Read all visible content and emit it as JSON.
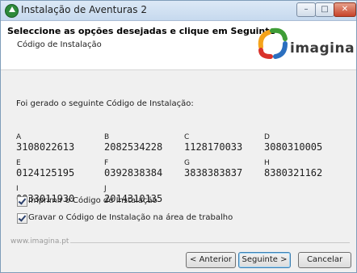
{
  "window": {
    "title": "Instalação de Aventuras 2",
    "controls": {
      "minimize": "–",
      "maximize": "□",
      "close": "✕"
    }
  },
  "header": {
    "title": "Seleccione as opções desejadas e clique em Seguinte",
    "subtitle": "Código de Instalação",
    "logo_text": "imagina",
    "logo_colors": [
      "#f5a31a",
      "#3f9d36",
      "#2b6fbf",
      "#d9322b"
    ]
  },
  "content": {
    "intro": "Foi gerado o seguinte Código de Instalação:",
    "codes": [
      {
        "letter": "A",
        "value": "3108022613"
      },
      {
        "letter": "B",
        "value": "2082534228"
      },
      {
        "letter": "C",
        "value": "1128170033"
      },
      {
        "letter": "D",
        "value": "3080310005"
      },
      {
        "letter": "E",
        "value": "0124125195"
      },
      {
        "letter": "F",
        "value": "0392838384"
      },
      {
        "letter": "G",
        "value": "3838383837"
      },
      {
        "letter": "H",
        "value": "8380321162"
      },
      {
        "letter": "I",
        "value": "0033011930"
      },
      {
        "letter": "J",
        "value": "2014310135"
      }
    ],
    "options": [
      {
        "label": "Imprimir o Código de Instalação",
        "checked": true
      },
      {
        "label": "Gravar o Código de Instalação na área de trabalho",
        "checked": true
      }
    ]
  },
  "footer": {
    "brand": "www.imagina.pt",
    "buttons": {
      "previous": "< Anterior",
      "next": "Seguinte >",
      "cancel": "Cancelar"
    }
  }
}
